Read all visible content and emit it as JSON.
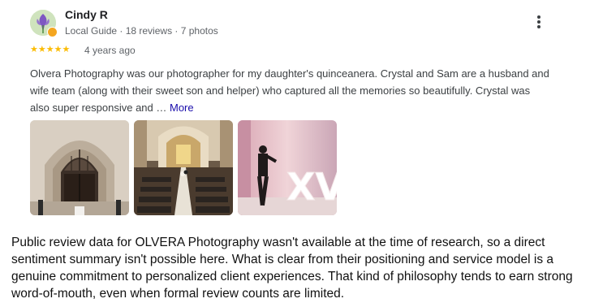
{
  "review": {
    "reviewer_name": "Cindy R",
    "reviewer_meta": "Local Guide · 18 reviews · 7 photos",
    "rating": 5,
    "stars": "★★★★★",
    "date": "4 years ago",
    "text": "Olvera Photography was our photographer for my daughter's quinceanera. Crystal and Sam are a husband and wife team (along with their sweet son and helper) who captured all the memories so beautifully. Crystal was also super responsive and … ",
    "more_label": "More",
    "more_options_icon": "more-vert-icon",
    "photos": [
      {
        "subject": "church-entrance"
      },
      {
        "subject": "church-interior-aisle"
      },
      {
        "subject": "quinceanera-reception-xv"
      }
    ],
    "photo_3_letters": "XV"
  },
  "summary": {
    "text": "Public review data for OLVERA Photography wasn't available at the time of research, so a direct sentiment summary isn't possible here. What is clear from their positioning and service model is a genuine commitment to personalized client experiences. That kind of philosophy tends to earn strong word-of-mouth, even when formal review counts are limited."
  },
  "colors": {
    "star": "#fbbc04",
    "link": "#1a0dab",
    "meta_text": "#5f6368"
  }
}
